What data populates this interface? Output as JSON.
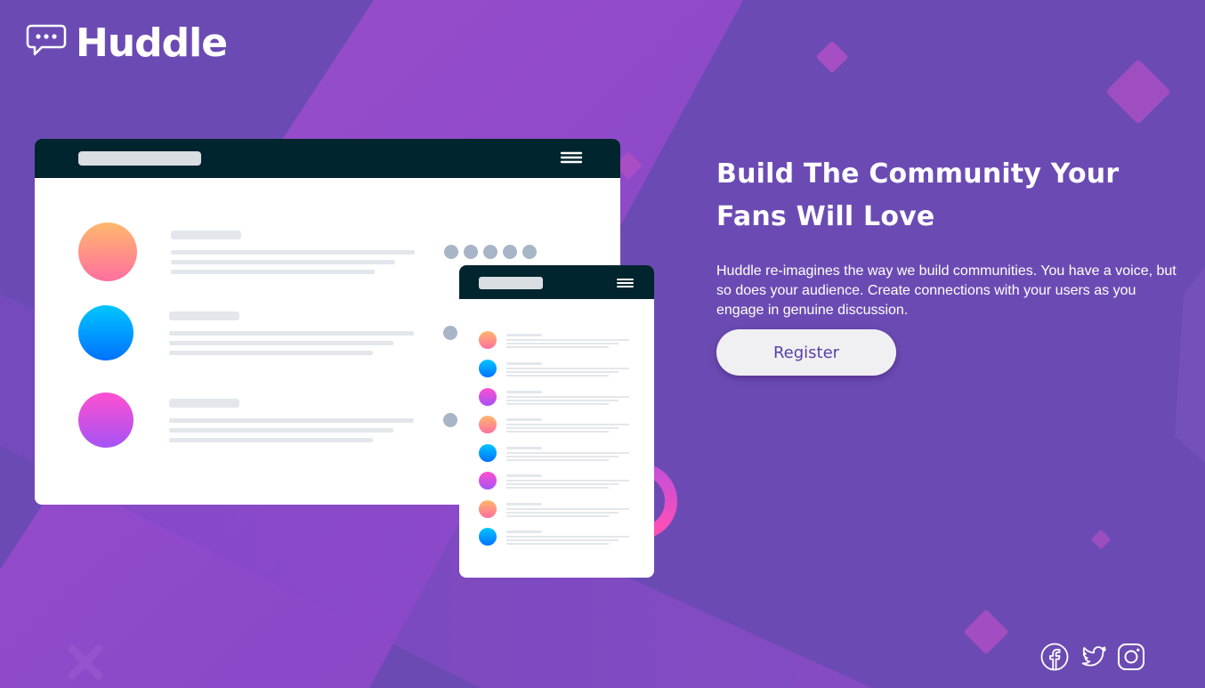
{
  "brand": {
    "name": "Huddle",
    "logo_icon": "speech-bubble-icon"
  },
  "hero": {
    "title_line1": "Build The Community Your",
    "title_line2": "Fans Will Love",
    "description": "Huddle re-imagines the way we build communities. You have a voice, but so does your audience. Create connections with your users as you engage in genuine discussion.",
    "register_label": "Register"
  },
  "social": [
    {
      "name": "facebook-icon"
    },
    {
      "name": "twitter-icon"
    },
    {
      "name": "instagram-icon"
    }
  ],
  "colors": {
    "background": "#6b4bb3",
    "accent_violet": "#9a4bd1",
    "button_text": "#5b3ea8",
    "mock_header": "#00252e"
  }
}
